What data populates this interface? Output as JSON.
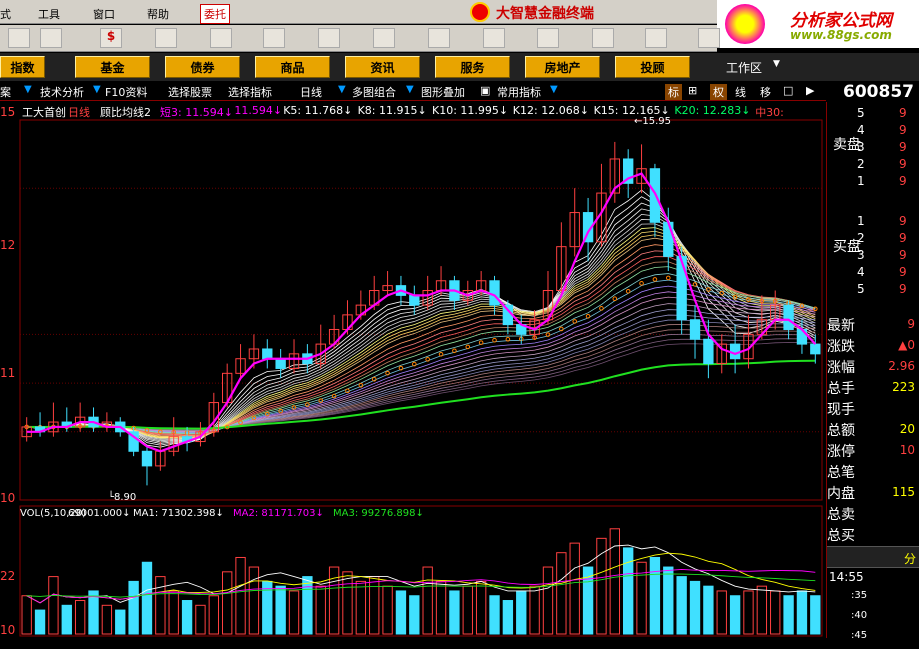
{
  "menu": {
    "items": [
      "式",
      "工具",
      "窗口",
      "帮助"
    ],
    "active": "委托",
    "app_title": "大智慧金融终端"
  },
  "logo": {
    "text": "分析家公式网",
    "url": "www.88gs.com"
  },
  "nav": {
    "buttons": [
      "指数",
      "基金",
      "债券",
      "商品",
      "资讯",
      "服务",
      "房地产",
      "投顾"
    ],
    "workspace": "工作区"
  },
  "subbar": {
    "items": [
      "案",
      "技术分析",
      "F10资料",
      "选择股票",
      "选择指标",
      "日线",
      "多图组合",
      "图形叠加",
      "常用指标"
    ],
    "right_buttons": [
      "标",
      "权",
      "线",
      "移"
    ]
  },
  "stock": {
    "code": "600857",
    "name": "工大首创",
    "period": "日线",
    "indicator": "顾比均线2"
  },
  "ma_line": {
    "items": [
      {
        "text": "短3: 11.594↓",
        "color": "#ff00ff"
      },
      {
        "text": "11.594↓",
        "color": "#ff00ff"
      },
      {
        "text": "K5: 11.768↓",
        "color": "#ffffff"
      },
      {
        "text": "K8: 11.915↓",
        "color": "#ffffff"
      },
      {
        "text": "K10: 11.995↓",
        "color": "#ffffff"
      },
      {
        "text": "K12: 12.068↓",
        "color": "#ffffff"
      },
      {
        "text": "K15: 12.165↓",
        "color": "#ffffff"
      },
      {
        "text": "K20: 12.283↓",
        "color": "#00ff66"
      },
      {
        "text": "中30:",
        "color": "#ff4040"
      }
    ]
  },
  "chart_data": {
    "type": "candlestick",
    "y_labels": [
      "15",
      "12",
      "11",
      "10"
    ],
    "annotations": [
      {
        "text": "15.95"
      },
      {
        "text": "8.90"
      }
    ],
    "candles": [
      {
        "o": 9.9,
        "c": 10.1,
        "h": 10.3,
        "l": 9.8
      },
      {
        "o": 10.1,
        "c": 10.0,
        "h": 10.4,
        "l": 9.9
      },
      {
        "o": 10.0,
        "c": 10.2,
        "h": 10.6,
        "l": 9.9
      },
      {
        "o": 10.2,
        "c": 10.1,
        "h": 10.5,
        "l": 10.0
      },
      {
        "o": 10.1,
        "c": 10.3,
        "h": 10.6,
        "l": 10.0
      },
      {
        "o": 10.3,
        "c": 10.1,
        "h": 10.5,
        "l": 10.0
      },
      {
        "o": 10.1,
        "c": 10.2,
        "h": 10.4,
        "l": 10.0
      },
      {
        "o": 10.2,
        "c": 10.0,
        "h": 10.3,
        "l": 9.9
      },
      {
        "o": 10.0,
        "c": 9.6,
        "h": 10.1,
        "l": 9.5
      },
      {
        "o": 9.6,
        "c": 9.3,
        "h": 9.7,
        "l": 8.9
      },
      {
        "o": 9.3,
        "c": 9.6,
        "h": 9.8,
        "l": 9.2
      },
      {
        "o": 9.6,
        "c": 9.9,
        "h": 10.3,
        "l": 9.5
      },
      {
        "o": 9.9,
        "c": 9.8,
        "h": 10.1,
        "l": 9.6
      },
      {
        "o": 9.8,
        "c": 10.0,
        "h": 10.2,
        "l": 9.7
      },
      {
        "o": 10.0,
        "c": 10.6,
        "h": 10.8,
        "l": 9.9
      },
      {
        "o": 10.6,
        "c": 11.2,
        "h": 11.4,
        "l": 10.5
      },
      {
        "o": 11.2,
        "c": 11.5,
        "h": 11.8,
        "l": 11.1
      },
      {
        "o": 11.5,
        "c": 11.7,
        "h": 12.0,
        "l": 11.3
      },
      {
        "o": 11.7,
        "c": 11.5,
        "h": 11.9,
        "l": 11.3
      },
      {
        "o": 11.5,
        "c": 11.3,
        "h": 11.7,
        "l": 11.1
      },
      {
        "o": 11.3,
        "c": 11.6,
        "h": 11.9,
        "l": 11.2
      },
      {
        "o": 11.6,
        "c": 11.4,
        "h": 11.8,
        "l": 11.2
      },
      {
        "o": 11.4,
        "c": 11.8,
        "h": 12.2,
        "l": 11.3
      },
      {
        "o": 11.8,
        "c": 12.1,
        "h": 12.4,
        "l": 11.7
      },
      {
        "o": 12.1,
        "c": 12.4,
        "h": 12.7,
        "l": 12.0
      },
      {
        "o": 12.4,
        "c": 12.6,
        "h": 12.9,
        "l": 12.3
      },
      {
        "o": 12.6,
        "c": 12.9,
        "h": 13.2,
        "l": 12.5
      },
      {
        "o": 12.9,
        "c": 13.0,
        "h": 13.3,
        "l": 12.8
      },
      {
        "o": 13.0,
        "c": 12.8,
        "h": 13.2,
        "l": 12.6
      },
      {
        "o": 12.8,
        "c": 12.6,
        "h": 13.0,
        "l": 12.4
      },
      {
        "o": 12.6,
        "c": 12.9,
        "h": 13.2,
        "l": 12.5
      },
      {
        "o": 12.9,
        "c": 13.1,
        "h": 13.4,
        "l": 12.8
      },
      {
        "o": 13.1,
        "c": 12.7,
        "h": 13.2,
        "l": 12.5
      },
      {
        "o": 12.7,
        "c": 12.9,
        "h": 13.1,
        "l": 12.6
      },
      {
        "o": 12.9,
        "c": 13.1,
        "h": 13.3,
        "l": 12.8
      },
      {
        "o": 13.1,
        "c": 12.6,
        "h": 13.2,
        "l": 12.4
      },
      {
        "o": 12.6,
        "c": 12.2,
        "h": 12.7,
        "l": 12.0
      },
      {
        "o": 12.2,
        "c": 12.0,
        "h": 12.4,
        "l": 11.8
      },
      {
        "o": 12.0,
        "c": 12.3,
        "h": 12.5,
        "l": 11.9
      },
      {
        "o": 12.3,
        "c": 12.9,
        "h": 13.3,
        "l": 12.2
      },
      {
        "o": 12.9,
        "c": 13.8,
        "h": 14.3,
        "l": 12.8
      },
      {
        "o": 13.8,
        "c": 14.5,
        "h": 15.0,
        "l": 13.6
      },
      {
        "o": 14.5,
        "c": 13.9,
        "h": 14.8,
        "l": 13.5
      },
      {
        "o": 13.9,
        "c": 14.9,
        "h": 15.5,
        "l": 13.8
      },
      {
        "o": 14.9,
        "c": 15.6,
        "h": 15.95,
        "l": 14.7
      },
      {
        "o": 15.6,
        "c": 15.1,
        "h": 15.8,
        "l": 14.8
      },
      {
        "o": 15.1,
        "c": 15.4,
        "h": 15.9,
        "l": 14.9
      },
      {
        "o": 15.4,
        "c": 14.3,
        "h": 15.5,
        "l": 14.0
      },
      {
        "o": 14.3,
        "c": 13.6,
        "h": 14.6,
        "l": 13.3
      },
      {
        "o": 13.6,
        "c": 12.3,
        "h": 13.8,
        "l": 12.0
      },
      {
        "o": 12.3,
        "c": 11.9,
        "h": 12.6,
        "l": 11.5
      },
      {
        "o": 11.9,
        "c": 11.4,
        "h": 12.3,
        "l": 11.1
      },
      {
        "o": 11.4,
        "c": 11.8,
        "h": 12.0,
        "l": 11.2
      },
      {
        "o": 11.8,
        "c": 11.5,
        "h": 12.2,
        "l": 11.2
      },
      {
        "o": 11.5,
        "c": 12.0,
        "h": 12.4,
        "l": 11.3
      },
      {
        "o": 12.0,
        "c": 12.3,
        "h": 12.8,
        "l": 11.9
      },
      {
        "o": 12.3,
        "c": 12.6,
        "h": 12.9,
        "l": 12.1
      },
      {
        "o": 12.6,
        "c": 12.1,
        "h": 12.7,
        "l": 11.9
      },
      {
        "o": 12.1,
        "c": 11.8,
        "h": 12.3,
        "l": 11.6
      },
      {
        "o": 11.8,
        "c": 11.6,
        "h": 12.0,
        "l": 11.4
      }
    ],
    "ma_fast": [
      10.0,
      10.0,
      10.1,
      10.1,
      10.2,
      10.2,
      10.1,
      10.1,
      9.9,
      9.7,
      9.6,
      9.7,
      9.8,
      9.9,
      10.2,
      10.6,
      11.1,
      11.4,
      11.5,
      11.5,
      11.5,
      11.5,
      11.6,
      11.8,
      12.1,
      12.4,
      12.6,
      12.8,
      12.9,
      12.8,
      12.8,
      12.9,
      12.9,
      12.8,
      12.9,
      12.8,
      12.5,
      12.2,
      12.1,
      12.3,
      12.8,
      13.5,
      14.1,
      14.5,
      15.0,
      15.2,
      15.3,
      14.9,
      14.3,
      13.5,
      12.7,
      12.0,
      11.7,
      11.6,
      11.7,
      12.0,
      12.3,
      12.3,
      12.1,
      11.8
    ],
    "ma_slow_band": [
      {
        "start": 9.95,
        "end": 11.4
      },
      {
        "start": 9.9,
        "end": 11.2
      },
      {
        "start": 9.85,
        "end": 11.0
      },
      {
        "start": 9.8,
        "end": 10.8
      }
    ],
    "volume": {
      "label": "VOL(5,10,20)",
      "value": "69001.000↓",
      "ma1": "MA1: 71302.398↓",
      "ma2": "MA2: 81171.703↓",
      "ma3": "MA3: 99276.898↓",
      "bars": [
        40,
        25,
        60,
        30,
        35,
        45,
        30,
        25,
        55,
        75,
        60,
        45,
        35,
        30,
        40,
        65,
        80,
        70,
        55,
        50,
        45,
        60,
        50,
        70,
        65,
        55,
        60,
        50,
        45,
        40,
        70,
        55,
        45,
        50,
        55,
        40,
        35,
        45,
        50,
        70,
        85,
        95,
        70,
        100,
        110,
        90,
        75,
        80,
        70,
        60,
        55,
        50,
        45,
        40,
        45,
        50,
        45,
        40,
        45,
        40
      ],
      "y_labels": [
        "22",
        "10"
      ]
    }
  },
  "right": {
    "sell_label": "卖盘",
    "buy_label": "买盘",
    "sell_levels": [
      "5",
      "4",
      "3",
      "2",
      "1"
    ],
    "buy_levels": [
      "1",
      "2",
      "3",
      "4",
      "5"
    ],
    "quote_labels": [
      "最新",
      "涨跌",
      "涨幅",
      "总手",
      "现手",
      "总额",
      "涨停",
      "总笔",
      "内盘",
      "总卖",
      "总买"
    ],
    "quote_vals": [
      "9",
      "▲0",
      "2.96",
      "223",
      "",
      "20",
      "10",
      "",
      "115",
      "",
      ""
    ],
    "time": "14:55",
    "ticks": [
      ":35",
      ":40",
      ":45"
    ]
  }
}
